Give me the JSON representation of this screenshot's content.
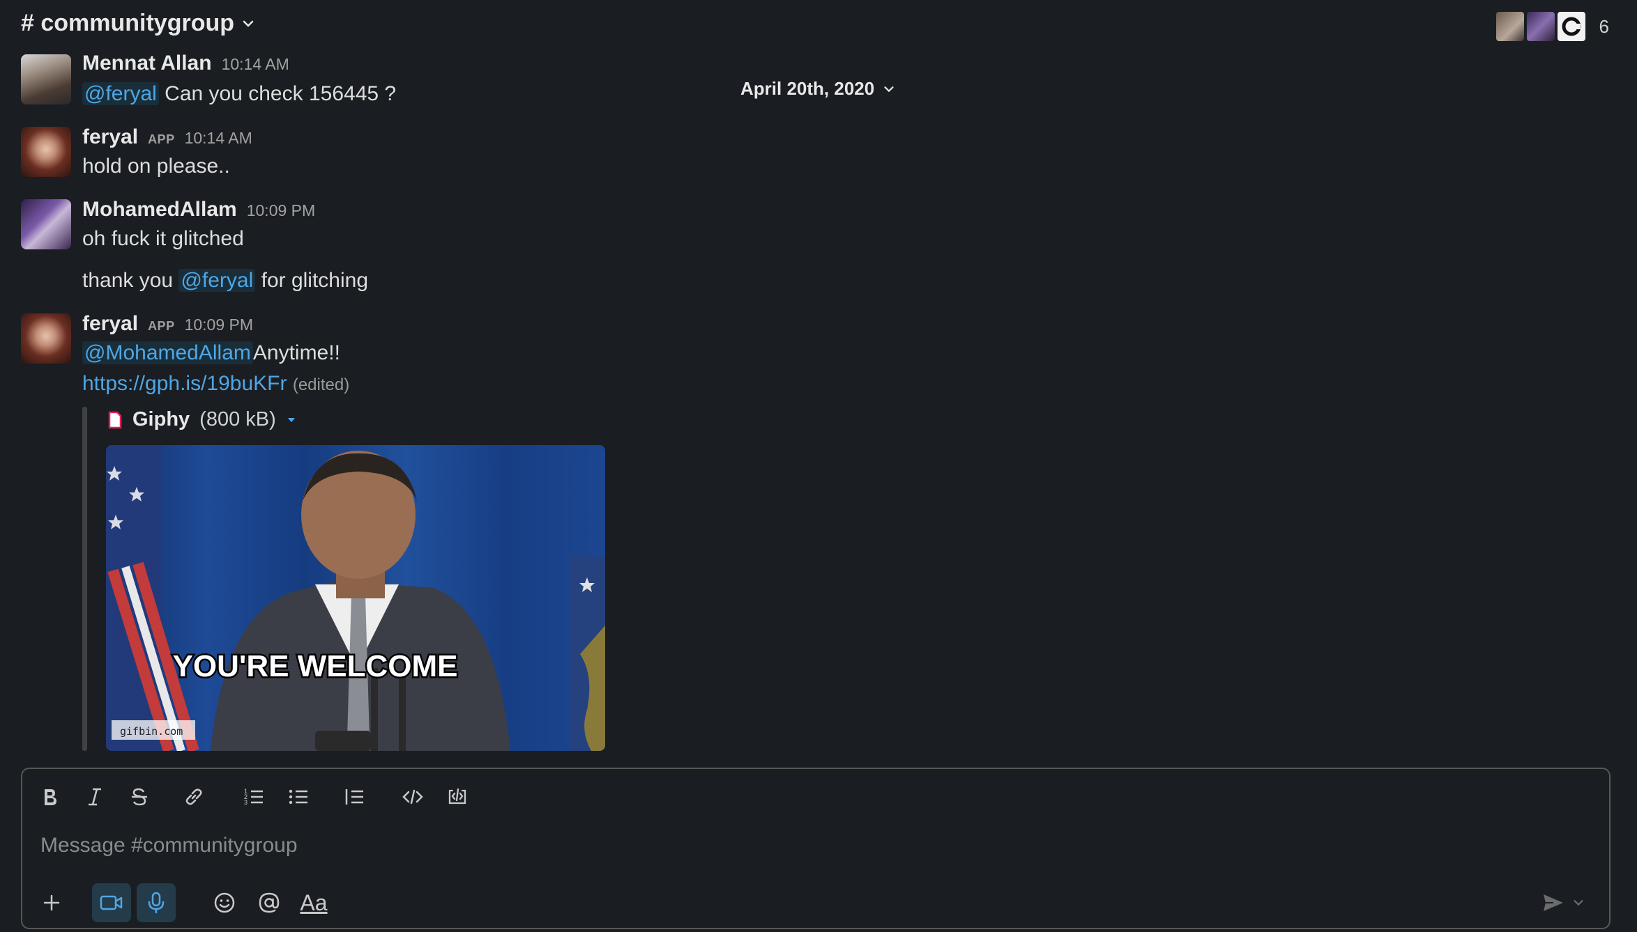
{
  "channel": {
    "name": "# communitygroup",
    "member_count": "6"
  },
  "date_divider": "April 20th, 2020",
  "messages": [
    {
      "author": "Mennat Allan",
      "time": "10:14 AM",
      "mention": "@feryal",
      "text": "Can you check 156445 ?"
    },
    {
      "author": "feryal",
      "badge": "APP",
      "time": "10:14 AM",
      "text": "hold on please.."
    },
    {
      "author": "MohamedAllam",
      "time": "10:09 PM",
      "text": "oh fuck it glitched",
      "followup_before": "thank you",
      "followup_mention": "@feryal",
      "followup_after": "for glitching"
    },
    {
      "author": "feryal",
      "badge": "APP",
      "time": "10:09 PM",
      "mention": "@MohamedAllam",
      "text": "Anytime!!",
      "link": "https://gph.is/19buKFr",
      "edited": "(edited)"
    }
  ],
  "attachment": {
    "name": "Giphy",
    "size": "(800 kB)",
    "gif_caption": "YOU'RE WELCOME",
    "gif_watermark": "gifbin.com"
  },
  "composer": {
    "placeholder": "Message #communitygroup",
    "format_label": "Aa"
  },
  "icons": [
    "chevron-down-icon",
    "bold-icon",
    "italic-icon",
    "strikethrough-icon",
    "link-icon",
    "ordered-list-icon",
    "bulleted-list-icon",
    "blockquote-icon",
    "code-icon",
    "code-block-icon",
    "plus-icon",
    "video-icon",
    "microphone-icon",
    "emoji-icon",
    "at-icon",
    "send-icon",
    "file-icon"
  ],
  "colors": {
    "background": "#1a1d21",
    "mention": "#4ea7e6",
    "active_button": "#243b4a"
  }
}
